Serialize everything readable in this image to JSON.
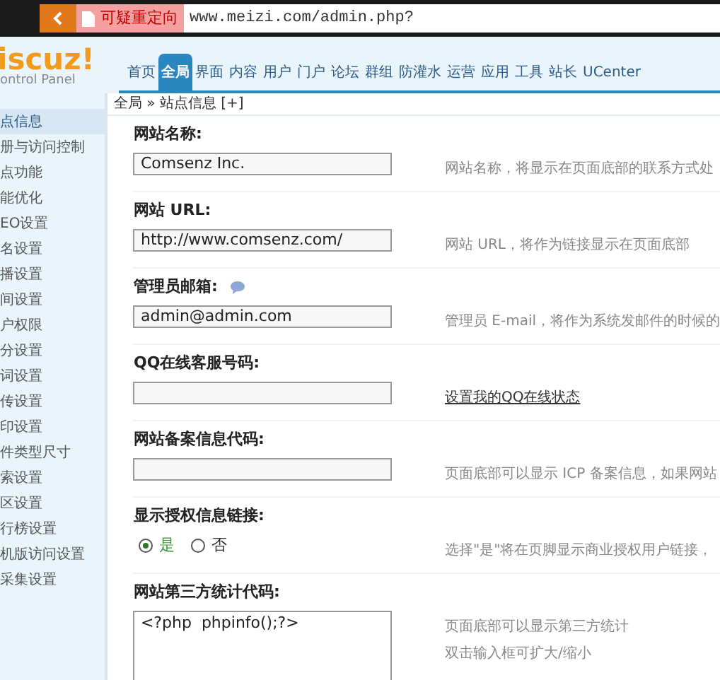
{
  "browser": {
    "warning": "可疑重定向",
    "url": "www.meizi.com/admin.php?"
  },
  "logo": {
    "name": "iscuz!",
    "subtitle": "ontrol Panel"
  },
  "nav": [
    {
      "label": "首页",
      "selected": false
    },
    {
      "label": "全局",
      "selected": true
    },
    {
      "label": "界面",
      "selected": false
    },
    {
      "label": "内容",
      "selected": false
    },
    {
      "label": "用户",
      "selected": false
    },
    {
      "label": "门户",
      "selected": false
    },
    {
      "label": "论坛",
      "selected": false
    },
    {
      "label": "群组",
      "selected": false
    },
    {
      "label": "防灌水",
      "selected": false
    },
    {
      "label": "运营",
      "selected": false
    },
    {
      "label": "应用",
      "selected": false
    },
    {
      "label": "工具",
      "selected": false
    },
    {
      "label": "站长",
      "selected": false
    },
    {
      "label": "UCenter",
      "selected": false
    }
  ],
  "breadcrumb": "全局 » 站点信息 [+]",
  "sidebar": {
    "items": [
      {
        "label": "点信息",
        "selected": true
      },
      {
        "label": "册与访问控制",
        "selected": false
      },
      {
        "label": "点功能",
        "selected": false
      },
      {
        "label": "能优化",
        "selected": false
      },
      {
        "label": "EO设置",
        "selected": false
      },
      {
        "label": "名设置",
        "selected": false
      },
      {
        "label": "播设置",
        "selected": false
      },
      {
        "label": "间设置",
        "selected": false
      },
      {
        "label": "户权限",
        "selected": false
      },
      {
        "label": "分设置",
        "selected": false
      },
      {
        "label": "词设置",
        "selected": false
      },
      {
        "label": "传设置",
        "selected": false
      },
      {
        "label": "印设置",
        "selected": false
      },
      {
        "label": "件类型尺寸",
        "selected": false
      },
      {
        "label": "索设置",
        "selected": false
      },
      {
        "label": "区设置",
        "selected": false
      },
      {
        "label": "行榜设置",
        "selected": false
      },
      {
        "label": "机版访问设置",
        "selected": false
      },
      {
        "label": "采集设置",
        "selected": false
      }
    ]
  },
  "settings": [
    {
      "kind": "text",
      "label": "网站名称:",
      "value": "Comsenz Inc.",
      "hint": [
        "网站名称，将显示在页面底部的联系方式处"
      ]
    },
    {
      "kind": "text",
      "label": "网站 URL:",
      "value": "http://www.comsenz.com/",
      "hint": [
        "网站 URL，将作为链接显示在页面底部"
      ]
    },
    {
      "kind": "text",
      "label": "管理员邮箱:",
      "help": true,
      "value": "admin@admin.com",
      "hint": [
        "管理员 E-mail，将作为系统发邮件的时候的"
      ]
    },
    {
      "kind": "text",
      "label": "QQ在线客服号码:",
      "link": "设置我的QQ在线状态"
    },
    {
      "kind": "text",
      "label": "网站备案信息代码:",
      "hint": [
        "页面底部可以显示 ICP 备案信息，如果网站"
      ]
    },
    {
      "kind": "radio",
      "label": "显示授权信息链接:",
      "options": [
        {
          "label": "是",
          "selected": true
        },
        {
          "label": "否",
          "selected": false
        }
      ],
      "hint": [
        "选择\"是\"将在页脚显示商业授权用户链接，"
      ]
    },
    {
      "kind": "textarea",
      "label": "网站第三方统计代码:",
      "value": "<?php  phpinfo();?>",
      "hint": [
        "页面底部可以显示第三方统计",
        "双击输入框可扩大/缩小"
      ]
    }
  ]
}
